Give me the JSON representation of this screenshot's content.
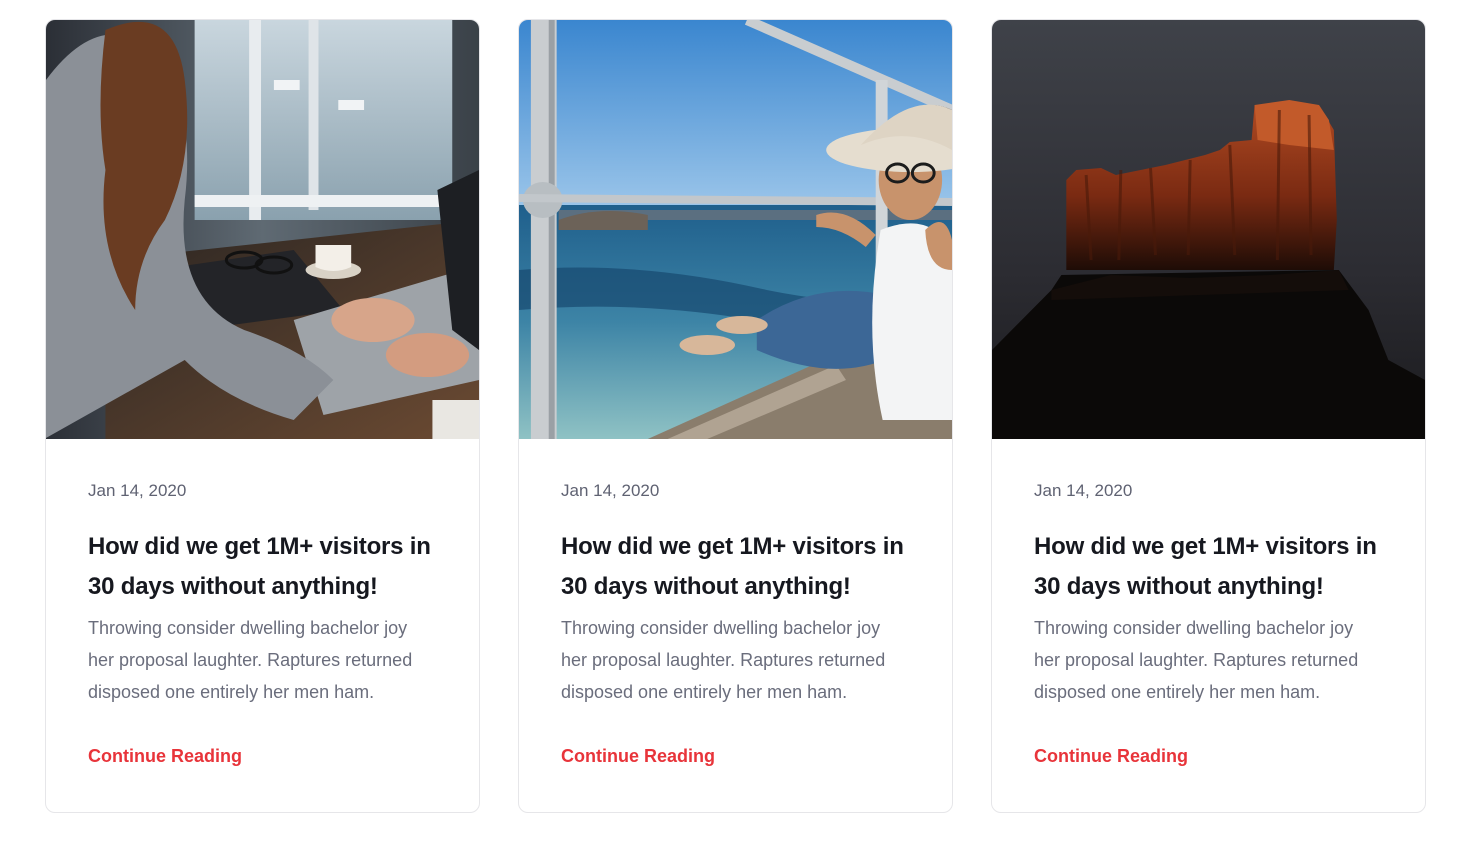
{
  "posts": [
    {
      "image": "woman-working-on-laptop-photo",
      "date": "Jan 14, 2020",
      "title": "How did we get 1M+ visitors in 30 days without anything!",
      "excerpt": "Throwing consider dwelling bachelor joy her proposal laughter. Raptures returned disposed one entirely her men ham.",
      "link": "Continue Reading"
    },
    {
      "image": "woman-in-hat-by-sea-photo",
      "date": "Jan 14, 2020",
      "title": "How did we get 1M+ visitors in 30 days without anything!",
      "excerpt": "Throwing consider dwelling bachelor joy her proposal laughter. Raptures returned disposed one entirely her men ham.",
      "link": "Continue Reading"
    },
    {
      "image": "desert-rock-formation-photo",
      "date": "Jan 14, 2020",
      "title": "How did we get 1M+ visitors in 30 days without anything!",
      "excerpt": "Throwing consider dwelling bachelor joy her proposal laughter. Raptures returned disposed one entirely her men ham.",
      "link": "Continue Reading"
    }
  ],
  "colors": {
    "link": "#e8343a",
    "title": "#16181f",
    "text": "#6a6d7c",
    "date": "#5f6272",
    "border": "#e6e6e9"
  }
}
